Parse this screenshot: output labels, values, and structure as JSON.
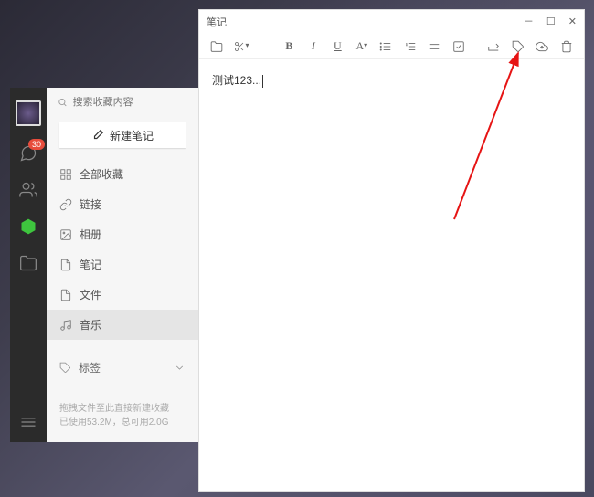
{
  "rail": {
    "chat_badge": "30"
  },
  "sidebar": {
    "search_placeholder": "搜索收藏内容",
    "new_note_label": "新建笔记",
    "items": [
      {
        "label": "全部收藏"
      },
      {
        "label": "链接"
      },
      {
        "label": "相册"
      },
      {
        "label": "笔记"
      },
      {
        "label": "文件"
      },
      {
        "label": "音乐"
      }
    ],
    "tags_label": "标签",
    "footer_line1": "拖拽文件至此直接新建收藏",
    "footer_line2": "已使用53.2M，总可用2.0G"
  },
  "note": {
    "title": "笔记",
    "content": "测试123..."
  }
}
